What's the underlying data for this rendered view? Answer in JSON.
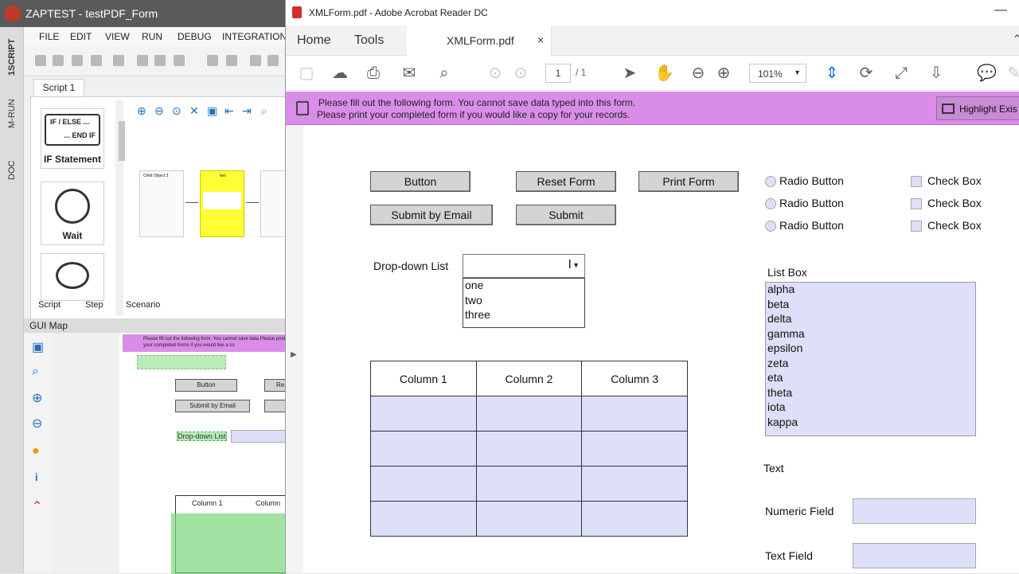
{
  "zaptest": {
    "title": "ZAPTEST - testPDF_Form",
    "side_tabs": [
      "1SCRIPT",
      "M-RUN",
      "DOC"
    ],
    "menu": [
      "FILE",
      "EDIT",
      "VIEW",
      "RUN",
      "DEBUG",
      "INTEGRATIONS"
    ],
    "script_tab": "Script 1",
    "blocks": [
      {
        "top_text": "IF / ELSE ...",
        "bottom_text": "... END IF",
        "label": "IF Statement"
      },
      {
        "label": "Wait"
      }
    ],
    "canvas_nodes": [
      "Child Object 3",
      "two"
    ],
    "bottom_tabs": [
      "Script",
      "Step",
      "Scenario"
    ],
    "gui_map_title": "GUI Map",
    "gui_preview": {
      "notice": "Please fill out the following form. You cannot save data Please print your completed forms if you would like a co",
      "button": "Button",
      "reset": "Re",
      "submit_email": "Submit by Email",
      "dropdown": "Drop-down List",
      "col1": "Column 1",
      "col2": "Column"
    }
  },
  "acrobat": {
    "title": "XMLForm.pdf - Adobe Acrobat Reader DC",
    "tabs": {
      "home": "Home",
      "tools": "Tools",
      "doc": "XMLForm.pdf",
      "close": "×"
    },
    "page_current": "1",
    "page_total": "/ 1",
    "zoom": "101%",
    "notice_line1": "Please fill out the following form. You cannot save data typed into this form.",
    "notice_line2": "Please print your completed form if you would like a copy for your records.",
    "highlight_button": "Highlight Exis"
  },
  "form": {
    "buttons": {
      "button": "Button",
      "reset": "Reset Form",
      "print": "Print Form",
      "submit_email": "Submit by Email",
      "submit": "Submit"
    },
    "radios": [
      "Radio Button",
      "Radio Button",
      "Radio Button"
    ],
    "checkboxes": [
      "Check Box",
      "Check Box",
      "Check Box"
    ],
    "dropdown_label": "Drop-down List",
    "dropdown_options": [
      "one",
      "two",
      "three"
    ],
    "table_headers": [
      "Column 1",
      "Column 2",
      "Column 3"
    ],
    "listbox_label": "List Box",
    "listbox_items": [
      "alpha",
      "beta",
      "delta",
      "gamma",
      "epsilon",
      "zeta",
      "eta",
      "theta",
      "iota",
      "kappa"
    ],
    "text_label": "Text",
    "numeric_label": "Numeric Field",
    "textfield_label": "Text Field"
  },
  "colors": {
    "notice_bg": "#d98de8",
    "field_fill": "#dde0f8",
    "zap_title": "#5a5a5a",
    "acrobat_blue": "#1473e6"
  }
}
